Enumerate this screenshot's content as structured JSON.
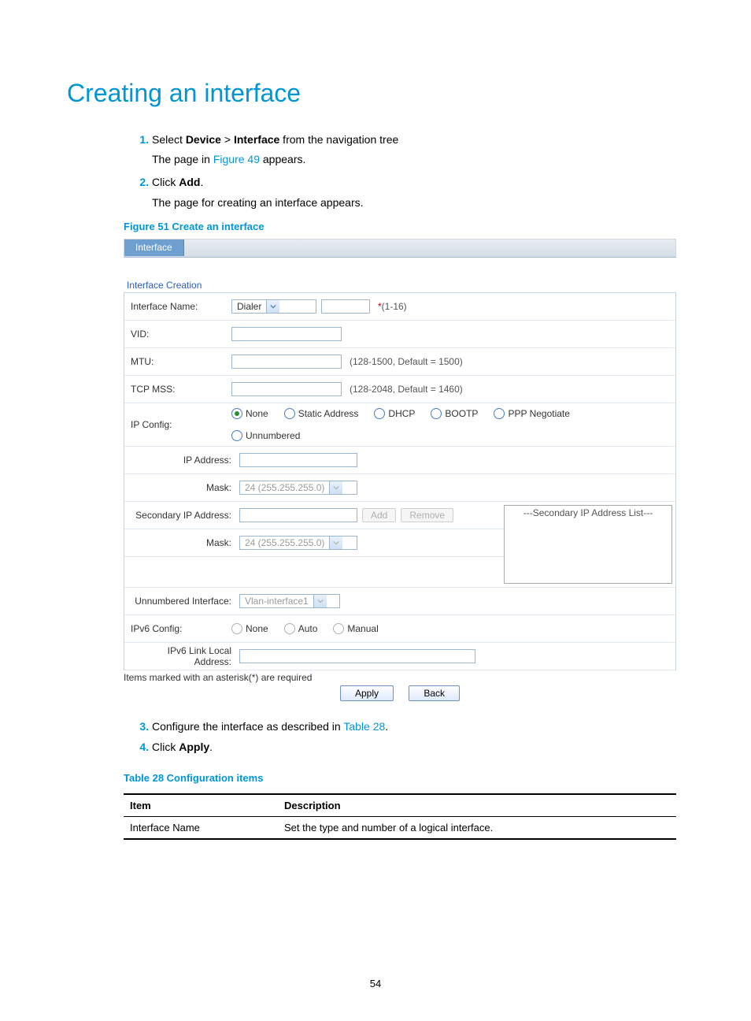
{
  "title": "Creating an interface",
  "steps1": {
    "s1_pre": "Select ",
    "s1_b1": "Device",
    "s1_mid": " > ",
    "s1_b2": "Interface",
    "s1_post": " from the navigation tree",
    "s1_sub_pre": "The page in ",
    "s1_sub_link": "Figure 49",
    "s1_sub_post": " appears.",
    "s2_pre": "Click ",
    "s2_b": "Add",
    "s2_post": ".",
    "s2_sub": "The page for creating an interface appears."
  },
  "figcap": "Figure 51 Create an interface",
  "shot": {
    "tab": "Interface",
    "section": "Interface Creation",
    "labels": {
      "ifname": "Interface Name:",
      "vid": "VID:",
      "mtu": "MTU:",
      "tcpmss": "TCP MSS:",
      "ipcfg": "IP Config:",
      "ipaddr": "IP Address:",
      "mask": "Mask:",
      "secip": "Secondary IP Address:",
      "mask2": "Mask:",
      "unnumif": "Unnumbered Interface:",
      "ipv6cfg": "IPv6 Config:",
      "ipv6lla": "IPv6 Link Local Address:"
    },
    "ifname_select": "Dialer",
    "ifname_range": "(1-16)",
    "mtu_hint": "(128-1500, Default = 1500)",
    "tcpmss_hint": "(128-2048, Default = 1460)",
    "ipcfg_options": [
      "None",
      "Static Address",
      "DHCP",
      "BOOTP",
      "PPP Negotiate",
      "Unnumbered"
    ],
    "ipcfg_selected": "None",
    "mask_select": "24 (255.255.255.0)",
    "add_btn": "Add",
    "remove_btn": "Remove",
    "sec_list_header": "---Secondary IP Address List---",
    "unnum_select": "Vlan-interface1",
    "ipv6_options": [
      "None",
      "Auto",
      "Manual"
    ],
    "foot_note": "Items marked with an asterisk(*) are required",
    "apply_btn": "Apply",
    "back_btn": "Back"
  },
  "steps2": {
    "s3_pre": "Configure the interface as described in ",
    "s3_link": "Table 28",
    "s3_post": ".",
    "s4_pre": "Click ",
    "s4_b": "Apply",
    "s4_post": "."
  },
  "tablecap": "Table 28 Configuration items",
  "cfg_table": {
    "h1": "Item",
    "h2": "Description",
    "r1c1": "Interface Name",
    "r1c2": "Set the type and number of a logical interface."
  },
  "page_num": "54"
}
